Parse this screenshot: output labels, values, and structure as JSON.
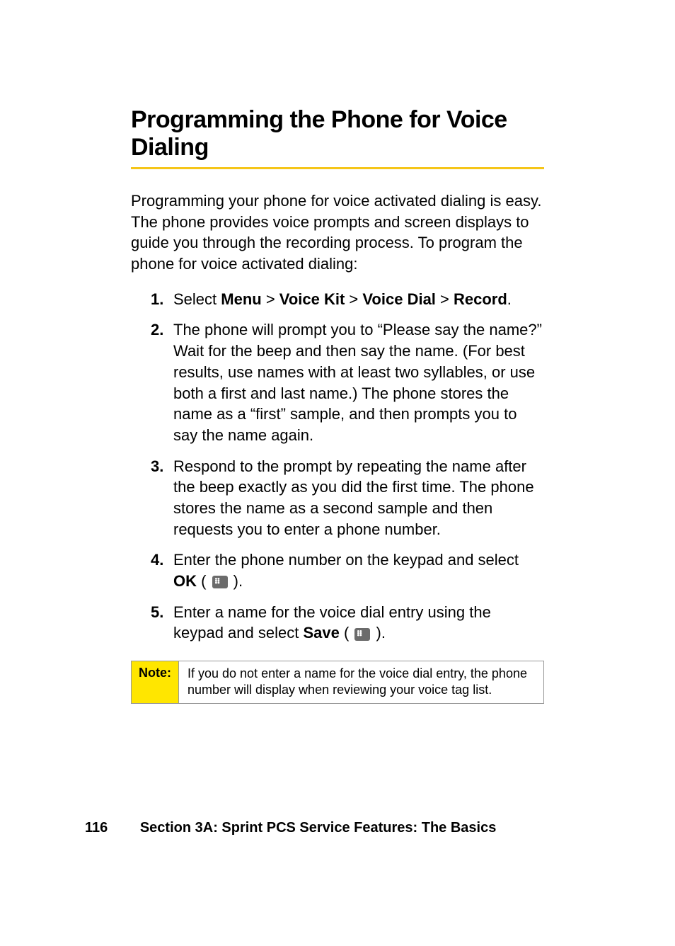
{
  "title": "Programming the Phone for Voice Dialing",
  "intro": "Programming your phone for voice activated dialing is easy. The phone provides voice prompts and screen displays to guide you through the recording process. To program the phone for voice activated dialing:",
  "steps": [
    {
      "num": "1.",
      "pre": "Select ",
      "path": [
        "Menu",
        "Voice Kit",
        "Voice Dial",
        "Record"
      ],
      "sep": " > ",
      "post": "."
    },
    {
      "num": "2.",
      "text": "The phone will prompt you to “Please say the name?” Wait for the beep and then say the name. (For best results, use names with at least two syllables, or use both a first and last name.) The phone stores the name as a “first” sample, and then prompts you to say the name again."
    },
    {
      "num": "3.",
      "text": "Respond to the prompt by repeating the name after the beep exactly as you did the first time. The phone stores the name as a second sample and then requests you to enter a phone number."
    },
    {
      "num": "4.",
      "pre": "Enter the phone number on the keypad and select ",
      "bold": "OK",
      "post_open": " ( ",
      "post_close": " )."
    },
    {
      "num": "5.",
      "pre": "Enter a name for the voice dial entry using the keypad and select ",
      "bold": "Save",
      "post_open": " ( ",
      "post_close": " )."
    }
  ],
  "note": {
    "label": "Note:",
    "text": "If you do not enter a name for the voice dial entry, the phone number will display when reviewing your voice tag list."
  },
  "footer": {
    "page_number": "116",
    "section": "Section 3A: Sprint PCS Service Features: The Basics"
  }
}
